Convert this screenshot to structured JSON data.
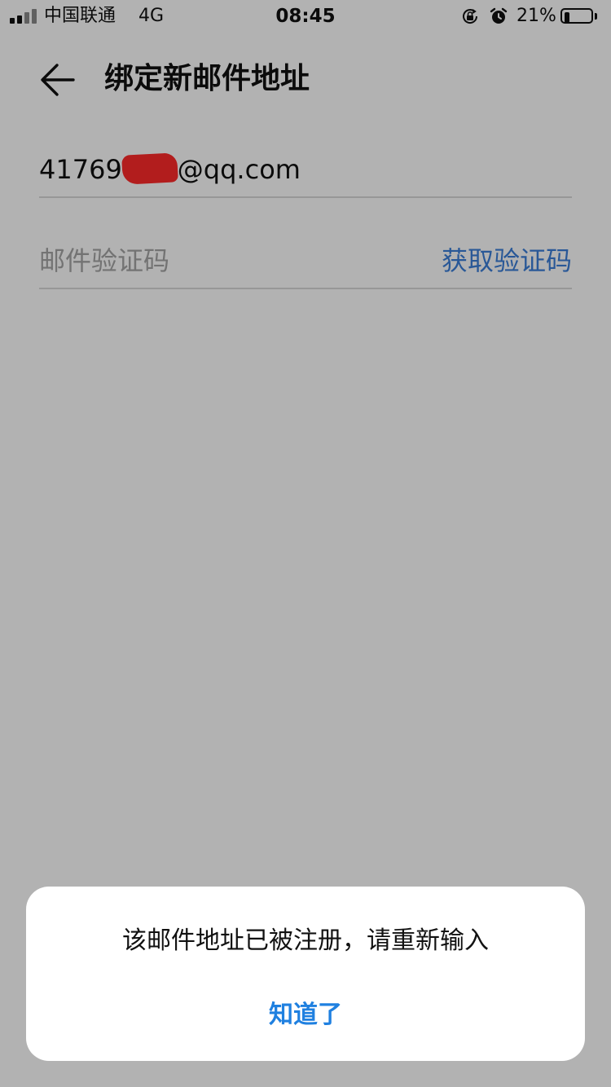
{
  "status_bar": {
    "carrier": "中国联通",
    "network": "4G",
    "time": "08:45",
    "battery": "21%",
    "battery_level": 0.21,
    "icons": [
      "signal-icon",
      "rotation-lock-icon",
      "alarm-icon",
      "battery-icon"
    ]
  },
  "header": {
    "title": "绑定新邮件地址",
    "back_icon": "back-arrow-icon"
  },
  "form": {
    "email_prefix": "41769",
    "email_suffix": "@qq.com",
    "code_placeholder": "邮件验证码",
    "get_code_label": "获取验证码"
  },
  "dialog": {
    "message": "该邮件地址已被注册，请重新输入",
    "confirm_label": "知道了"
  },
  "colors": {
    "accent": "#3b7ed8",
    "dialog_button": "#1f80e0",
    "redaction": "#ff2a2a",
    "placeholder": "#a5a5a5"
  }
}
